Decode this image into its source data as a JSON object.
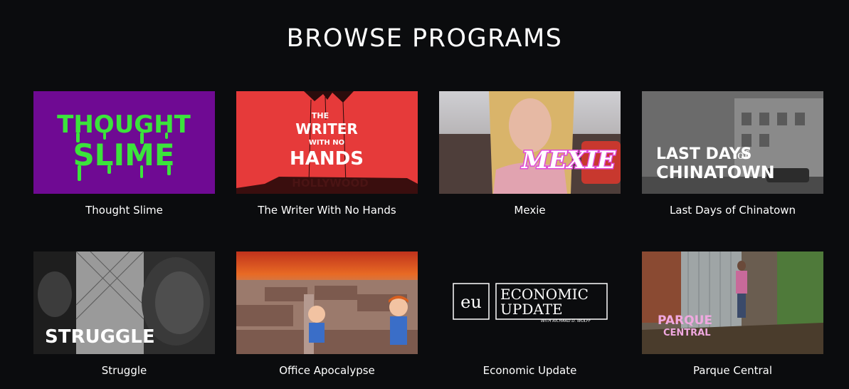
{
  "page": {
    "title": "BROWSE PROGRAMS"
  },
  "programs": [
    {
      "name": "Thought Slime",
      "art_text": [
        "THOUGHT",
        "SLIME"
      ]
    },
    {
      "name": "The Writer With No Hands",
      "art_text": [
        "THE",
        "WRITER",
        "WITH NO",
        "HANDS",
        "HOLLYWOOD"
      ]
    },
    {
      "name": "Mexie",
      "art_text": [
        "MEXIE"
      ]
    },
    {
      "name": "Last Days of Chinatown",
      "art_text": [
        "LAST DAYS",
        "of",
        "CHINATOWN"
      ]
    },
    {
      "name": "Struggle",
      "art_text": [
        "STRUGGLE"
      ]
    },
    {
      "name": "Office Apocalypse",
      "art_text": []
    },
    {
      "name": "Economic Update",
      "art_text": [
        "eu",
        "ECONOMIC",
        "UPDATE",
        "WITH RICHARD D. WOLFF"
      ]
    },
    {
      "name": "Parque Central",
      "art_text": [
        "PARQUE",
        "CENTRAL"
      ]
    }
  ],
  "colors": {
    "background": "#0b0c0e",
    "thought_slime_bg": "#6f0a93",
    "slime_green": "#3be43b",
    "writer_red": "#e63a3a",
    "mexie_pink": "#e04ad6"
  }
}
